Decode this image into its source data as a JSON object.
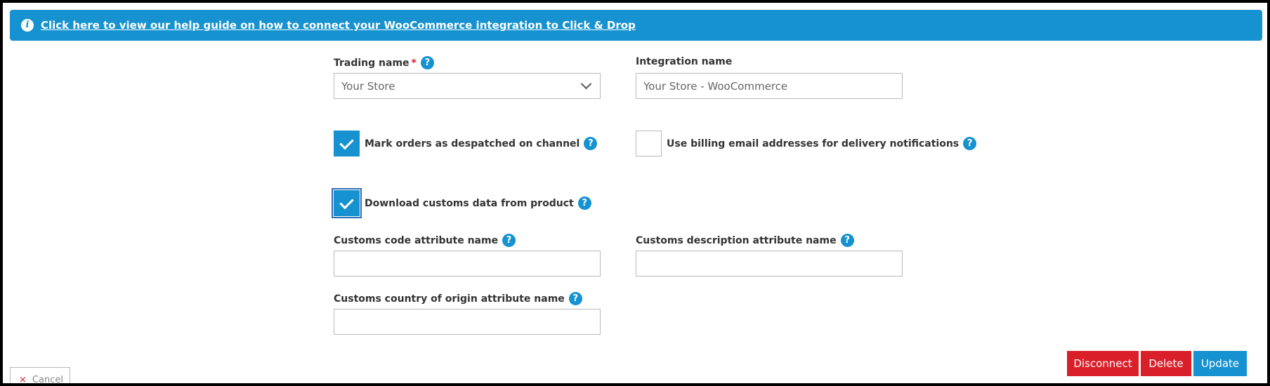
{
  "banner": {
    "icon": "info-icon",
    "link_text": "Click here to view our help guide on how to connect your WooCommerce integration to Click & Drop",
    "color": "#1592cf"
  },
  "form": {
    "trading_name": {
      "label": "Trading name",
      "required_mark": "*",
      "value": "Your Store"
    },
    "integration_name": {
      "label": "Integration name",
      "value": "Your Store - WooCommerce"
    },
    "mark_despatched": {
      "label": "Mark orders as despatched on channel",
      "checked": true
    },
    "billing_email": {
      "label": "Use billing email addresses for delivery notifications",
      "checked": false
    },
    "download_customs": {
      "label": "Download customs data from product",
      "checked": true
    },
    "customs_code": {
      "label": "Customs code attribute name",
      "value": ""
    },
    "customs_description": {
      "label": "Customs description attribute name",
      "value": ""
    },
    "customs_country": {
      "label": "Customs country of origin attribute name",
      "value": ""
    },
    "help_glyph": "?"
  },
  "actions": {
    "disconnect": "Disconnect",
    "delete": "Delete",
    "update": "Update",
    "cancel": "Cancel",
    "cancel_icon": "×"
  },
  "colors": {
    "accent": "#1592cf",
    "danger": "#d9202a"
  }
}
